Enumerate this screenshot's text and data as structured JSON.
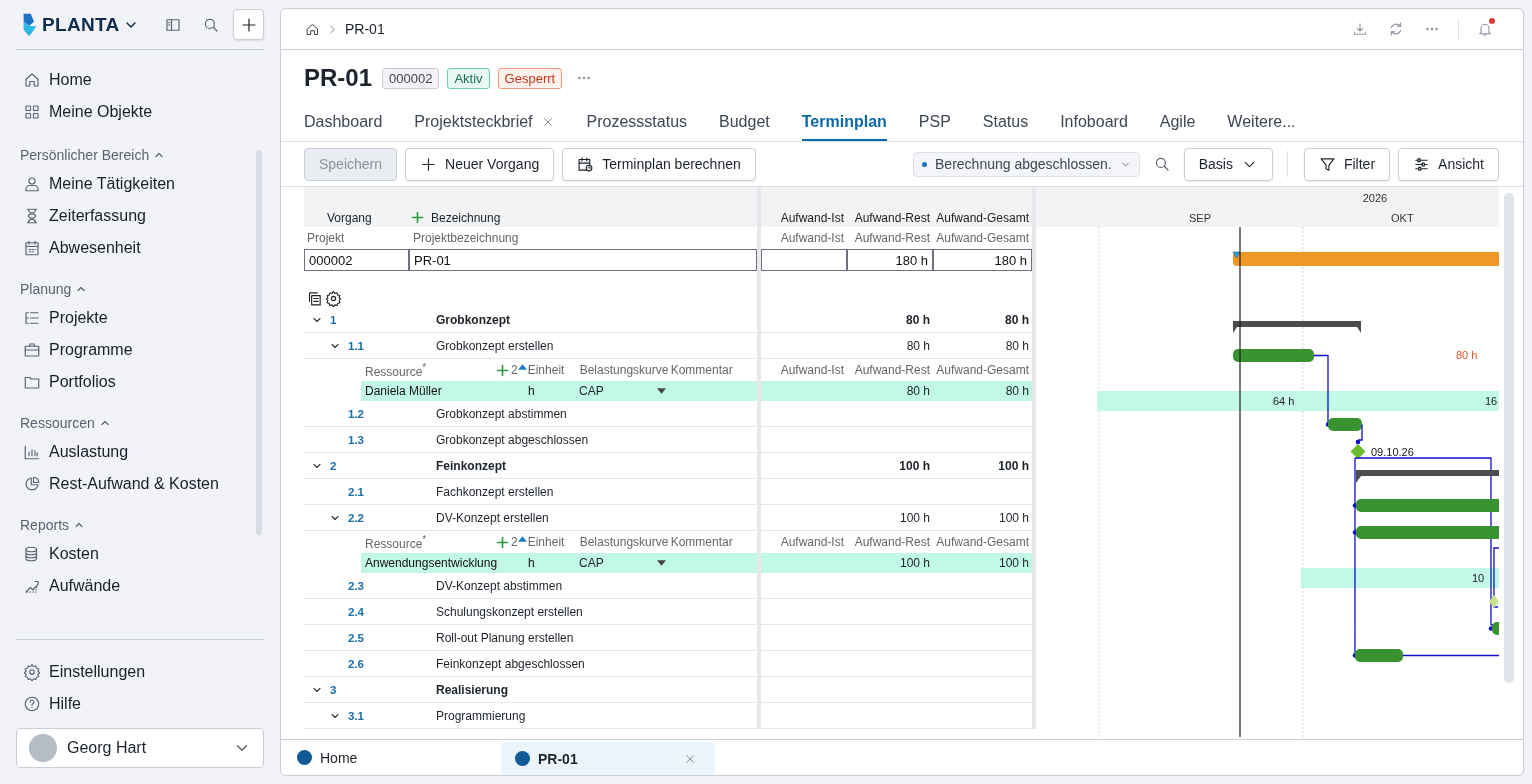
{
  "sidebar": {
    "logo": "PLANTA",
    "top_items": [
      {
        "label": "Home"
      },
      {
        "label": "Meine Objekte"
      }
    ],
    "sections": [
      {
        "title": "Persönlicher Bereich",
        "expanded": true,
        "items": [
          {
            "label": "Meine Tätigkeiten"
          },
          {
            "label": "Zeiterfassung"
          },
          {
            "label": "Abwesenheit"
          }
        ]
      },
      {
        "title": "Planung",
        "expanded": true,
        "items": [
          {
            "label": "Projekte"
          },
          {
            "label": "Programme"
          },
          {
            "label": "Portfolios"
          }
        ]
      },
      {
        "title": "Ressourcen",
        "expanded": true,
        "items": [
          {
            "label": "Auslastung"
          },
          {
            "label": "Rest-Aufwand & Kosten"
          }
        ]
      },
      {
        "title": "Reports",
        "expanded": true,
        "items": [
          {
            "label": "Kosten"
          },
          {
            "label": "Aufwände"
          }
        ]
      }
    ],
    "bottom_items": [
      {
        "label": "Einstellungen"
      },
      {
        "label": "Hilfe"
      }
    ],
    "user": {
      "name": "Georg Hart"
    }
  },
  "breadcrumb": {
    "current": "PR-01"
  },
  "header": {
    "title": "PR-01",
    "badges": [
      {
        "text": "000002",
        "kind": "id"
      },
      {
        "text": "Aktiv",
        "kind": "active"
      },
      {
        "text": "Gesperrt",
        "kind": "locked"
      }
    ]
  },
  "tabs": [
    {
      "label": "Dashboard",
      "selected": false
    },
    {
      "label": "Projektsteckbrief",
      "selected": false,
      "closable": true
    },
    {
      "label": "Prozessstatus",
      "selected": false
    },
    {
      "label": "Budget",
      "selected": false
    },
    {
      "label": "Terminplan",
      "selected": true
    },
    {
      "label": "PSP",
      "selected": false
    },
    {
      "label": "Status",
      "selected": false
    },
    {
      "label": "Infoboard",
      "selected": false
    },
    {
      "label": "Agile",
      "selected": false
    },
    {
      "label": "Weitere...",
      "selected": false
    }
  ],
  "toolbar": {
    "buttons": [
      {
        "label": "Speichern",
        "disabled": true
      },
      {
        "label": "Neuer Vorgang",
        "disabled": false
      },
      {
        "label": "Terminplan berechnen",
        "disabled": false
      }
    ],
    "status": "Berechnung abgeschlossen.",
    "baseline": "Basis",
    "filter": "Filter",
    "view": "Ansicht"
  },
  "table": {
    "columns": [
      "Vorgang",
      "Bezeichnung"
    ],
    "value_columns": [
      "Aufwand-Ist",
      "Aufwand-Rest",
      "Aufwand-Gesamt"
    ],
    "project_columns": [
      "Projekt",
      "Projektbezeichnung"
    ],
    "project_value_columns": [
      "Aufwand-Ist",
      "Aufwand-Rest",
      "Aufwand-Gesamt"
    ],
    "project": {
      "id": "000002",
      "name": "PR-01",
      "aufwand_rest": "180 h",
      "aufwand_gesamt": "180 h"
    },
    "tasks": [
      {
        "number": "1",
        "name": "Grobkonzept",
        "kind": "summary",
        "expanded": true,
        "aufwand_rest": "80 h",
        "aufwand_gesamt": "80 h",
        "children": [
          {
            "number": "1.1",
            "name": "Grobkonzept erstellen",
            "kind": "task",
            "expanded": true,
            "aufwand_rest": "80 h",
            "aufwand_gesamt": "80 h",
            "resources": {
              "columns": [
                "Ressource$^{*}$",
                "Einheit",
                "Belastungskurve",
                "Kommentar"
              ],
              "count": "2",
              "value_columns": [
                "Aufwand-Ist",
                "Aufwand-Rest",
                "Aufwand-Gesamt"
              ],
              "rows": [
                {
                  "name": "Daniela Müller",
                  "unit": "h",
                  "curve": "CAP",
                  "aufwand_rest": "80 h",
                  "aufwand_gesamt": "80 h"
                }
              ]
            }
          },
          {
            "number": "1.2",
            "name": "Grobkonzept abstimmen",
            "kind": "task"
          },
          {
            "number": "1.3",
            "name": "Grobkonzept abgeschlossen",
            "kind": "task"
          }
        ]
      },
      {
        "number": "2",
        "name": "Feinkonzept",
        "kind": "summary",
        "expanded": true,
        "aufwand_rest": "100 h",
        "aufwand_gesamt": "100 h",
        "children": [
          {
            "number": "2.1",
            "name": "Fachkonzept erstellen",
            "kind": "task"
          },
          {
            "number": "2.2",
            "name": "DV-Konzept erstellen",
            "kind": "task",
            "expanded": true,
            "aufwand_rest": "100 h",
            "aufwand_gesamt": "100 h",
            "resources": {
              "columns": [
                "Ressource$^{*}$",
                "Einheit",
                "Belastungskurve",
                "Kommentar"
              ],
              "count": "2",
              "value_columns": [
                "Aufwand-Ist",
                "Aufwand-Rest",
                "Aufwand-Gesamt"
              ],
              "rows": [
                {
                  "name": "Anwendungsentwicklung",
                  "unit": "h",
                  "curve": "CAP",
                  "aufwand_rest": "100 h",
                  "aufwand_gesamt": "100 h"
                }
              ]
            }
          },
          {
            "number": "2.3",
            "name": "DV-Konzept abstimmen",
            "kind": "task"
          },
          {
            "number": "2.4",
            "name": "Schulungskonzept erstellen",
            "kind": "task"
          },
          {
            "number": "2.5",
            "name": "Roll-out Planung erstellen",
            "kind": "task"
          },
          {
            "number": "2.6",
            "name": "Feinkonzept abgeschlossen",
            "kind": "task"
          }
        ]
      },
      {
        "number": "3",
        "name": "Realisierung",
        "kind": "summary",
        "expanded": true,
        "children": [
          {
            "number": "3.1",
            "name": "Programmierung",
            "kind": "task",
            "expanded": true
          }
        ]
      }
    ]
  },
  "gantt": {
    "year": "2026",
    "months": [
      "SEP",
      "OKT"
    ],
    "rest_label": "80 h",
    "load_label": "64 h",
    "load_label_cut": "16",
    "milestone_label": "09.10.26",
    "load_label_2": "10"
  },
  "bottom_tabs": [
    {
      "label": "Home",
      "selected": false
    },
    {
      "label": "PR-01",
      "selected": true,
      "closable": true
    }
  ]
}
